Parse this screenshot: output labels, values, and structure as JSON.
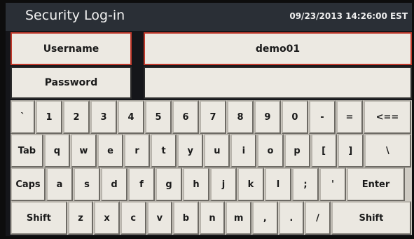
{
  "header": {
    "title": "Security Log-in",
    "datetime": "09/23/2013 14:26:00 EST"
  },
  "form": {
    "username_label": "Username",
    "username_value": "demo01",
    "password_label": "Password",
    "password_value": ""
  },
  "keyboard": {
    "row1": [
      "`",
      "1",
      "2",
      "3",
      "4",
      "5",
      "6",
      "7",
      "8",
      "9",
      "0",
      "-",
      "=",
      "<=="
    ],
    "row2": [
      "Tab",
      "q",
      "w",
      "e",
      "r",
      "t",
      "y",
      "u",
      "i",
      "o",
      "p",
      "[",
      "]",
      "\\"
    ],
    "row3": [
      "Caps",
      "a",
      "s",
      "d",
      "f",
      "g",
      "h",
      "j",
      "k",
      "l",
      ";",
      "'",
      "Enter"
    ],
    "row4": [
      "Shift",
      "z",
      "x",
      "c",
      "v",
      "b",
      "n",
      "m",
      ",",
      ".",
      "/",
      "Shift"
    ]
  },
  "colors": {
    "active_border": "#c0392b",
    "key_face": "#ebe8e1",
    "titlebar": "#2a2f36"
  }
}
